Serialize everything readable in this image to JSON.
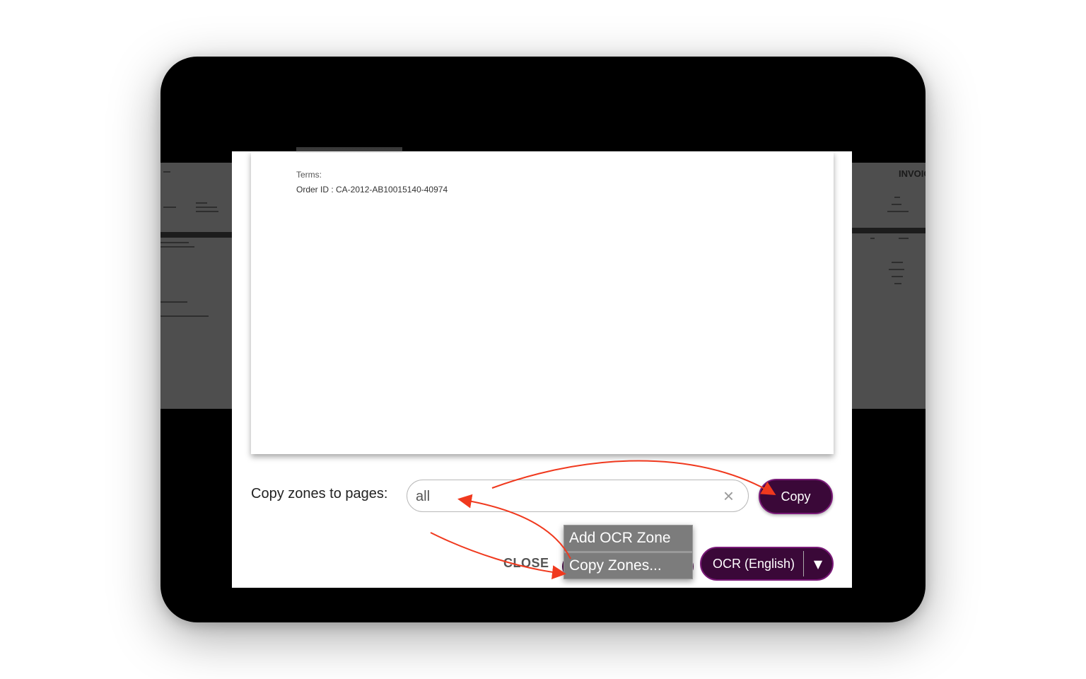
{
  "document": {
    "terms_label": "Terms:",
    "order_id": "Order ID : CA-2012-AB10015140-40974",
    "background_heading": "INVOIC"
  },
  "copy_zones": {
    "label": "Copy zones to pages:",
    "input_value": "all",
    "clear_icon": "×",
    "copy_button": "Copy"
  },
  "footer": {
    "close_button": "CLOSE",
    "ocr_button": "OCR (English)",
    "ocr_dropdown_icon": "▼"
  },
  "context_menu": {
    "items": [
      "Add OCR Zone",
      "Copy Zones..."
    ]
  },
  "colors": {
    "accent": "#3a0838",
    "annotation_arrow": "#f0391e"
  }
}
